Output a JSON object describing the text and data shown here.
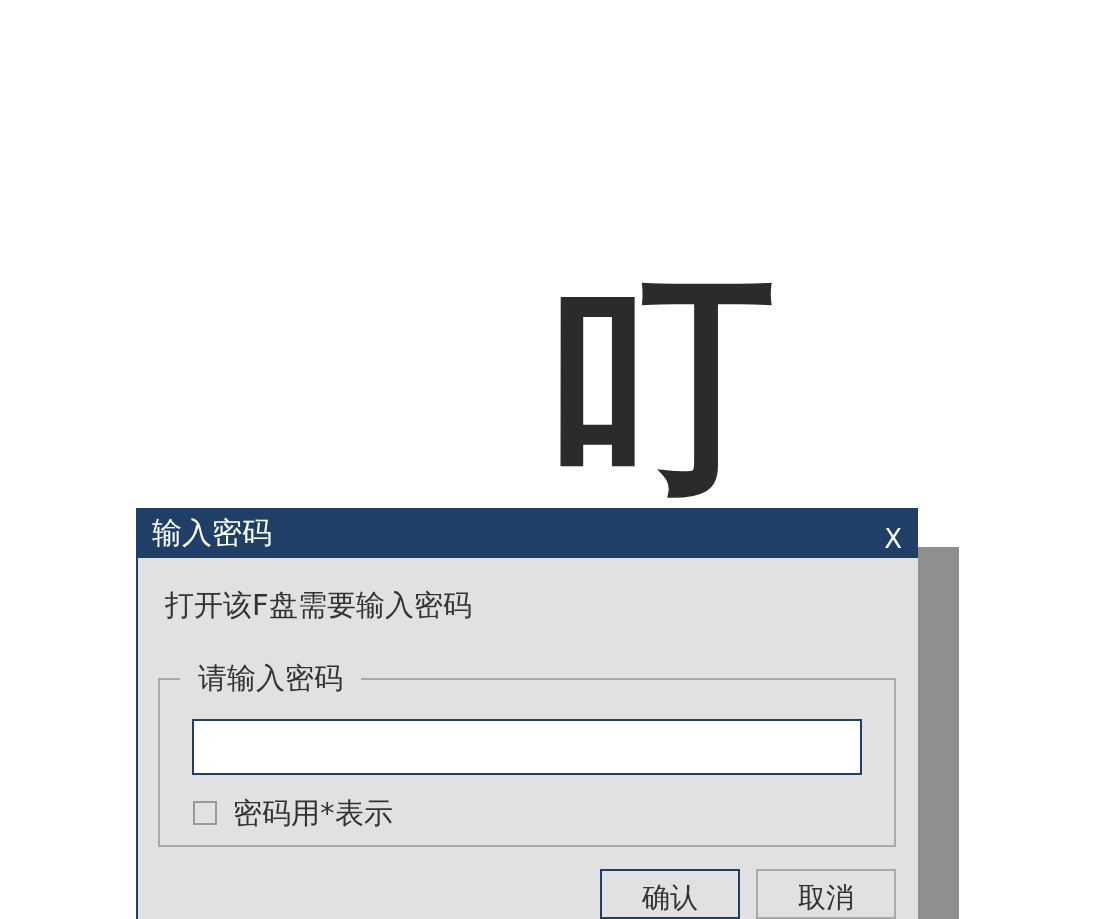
{
  "sound_effect": "叮",
  "dialog": {
    "title": "输入密码",
    "close": "X",
    "message": "打开该F盘需要输入密码",
    "group": {
      "legend": "请输入密码",
      "checkbox": {
        "label": "密码用*表示",
        "checked": false
      }
    },
    "buttons": [
      {
        "label": "确认",
        "default": true
      },
      {
        "label": "取消",
        "default": false
      }
    ]
  }
}
